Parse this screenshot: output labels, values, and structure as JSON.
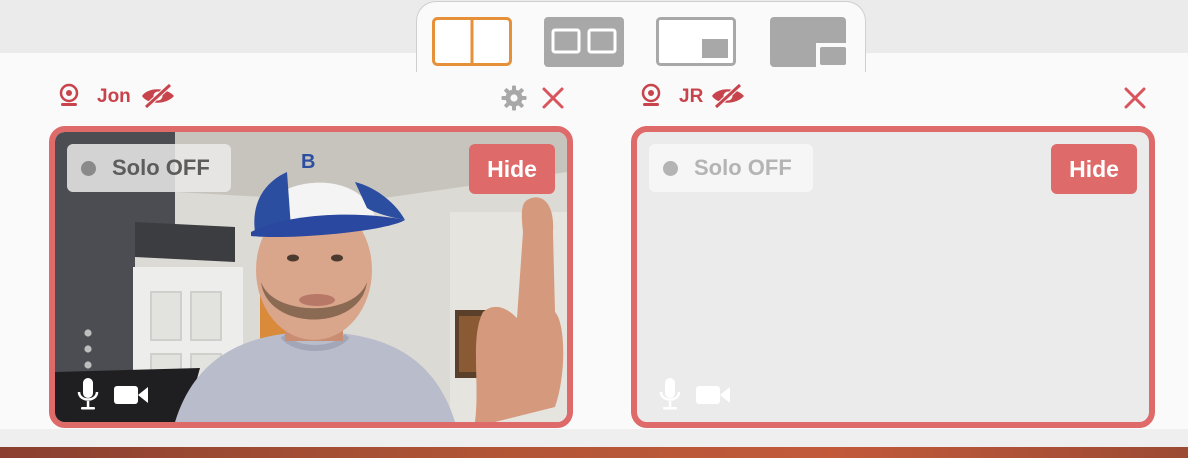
{
  "layout_switcher": {
    "options": [
      {
        "id": "side-by-side",
        "icon": "layout-side-by-side-icon",
        "selected": true
      },
      {
        "id": "split-framed",
        "icon": "layout-split-framed-icon",
        "selected": false
      },
      {
        "id": "picture-in-picture",
        "icon": "layout-pip-icon",
        "selected": false
      },
      {
        "id": "full-with-inset",
        "icon": "layout-full-inset-icon",
        "selected": false
      }
    ],
    "accent_color": "#e6913a"
  },
  "participants": [
    {
      "name": "Jon",
      "icons": [
        "webcam-icon",
        "eye-slash-icon",
        "gear-icon",
        "close-icon"
      ],
      "solo_label": "Solo OFF",
      "hide_label": "Hide",
      "video_on": true
    },
    {
      "name": "JR",
      "icons": [
        "webcam-icon",
        "eye-slash-icon",
        "close-icon"
      ],
      "solo_label": "Solo OFF",
      "hide_label": "Hide",
      "video_on": false
    }
  ],
  "colors": {
    "tile_border": "#de6a6a",
    "name_red": "#c8444c",
    "hide_button": "#de6a6a"
  }
}
